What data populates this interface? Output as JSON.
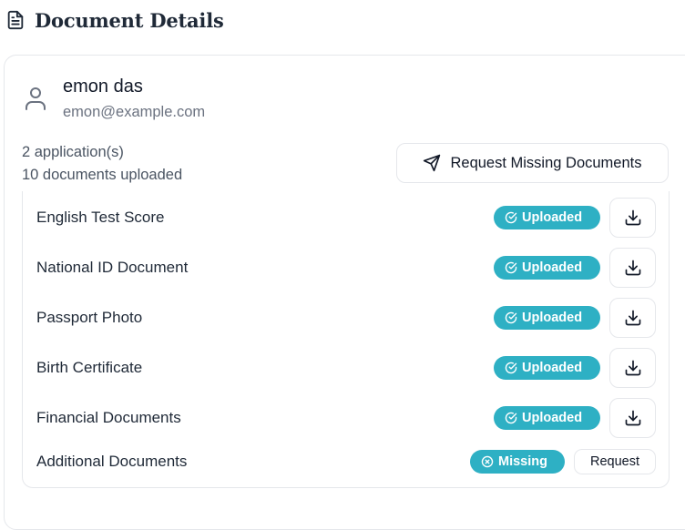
{
  "header": {
    "title": "Document Details",
    "icon": "file-text-icon"
  },
  "user": {
    "name": "emon das",
    "email": "emon@example.com",
    "icon": "user-icon"
  },
  "summary": {
    "applications": "2 application(s)",
    "documents": "10 documents uploaded"
  },
  "actions": {
    "request_missing_label": "Request Missing Documents",
    "request_missing_icon": "send-icon"
  },
  "documents": [
    {
      "name": "English Test Score",
      "status": "Uploaded",
      "action": "download"
    },
    {
      "name": "National ID Document",
      "status": "Uploaded",
      "action": "download"
    },
    {
      "name": "Passport Photo",
      "status": "Uploaded",
      "action": "download"
    },
    {
      "name": "Birth Certificate",
      "status": "Uploaded",
      "action": "download"
    },
    {
      "name": "Financial Documents",
      "status": "Uploaded",
      "action": "download"
    },
    {
      "name": "Additional Documents",
      "status": "Missing",
      "action": "Request"
    }
  ],
  "colors": {
    "status_badge": "#2eb0c4",
    "border": "#e5e7eb",
    "text_primary": "#1f2937",
    "text_muted": "#6b7280"
  }
}
